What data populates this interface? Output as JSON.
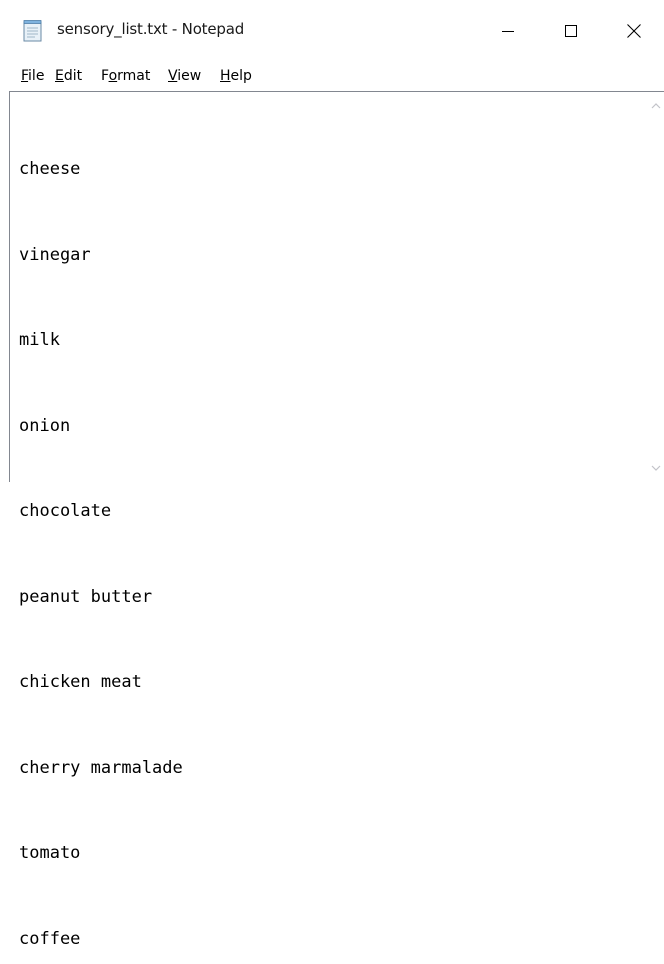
{
  "window": {
    "title": "sensory_list.txt - Notepad",
    "app_icon": "notepad-icon",
    "controls": {
      "minimize_icon": "minimize-icon",
      "maximize_icon": "maximize-icon",
      "close_icon": "close-icon"
    }
  },
  "menu": {
    "items": [
      {
        "mnemonic": "F",
        "rest": "ile"
      },
      {
        "mnemonic": "E",
        "rest": "dit"
      },
      {
        "pre": "F",
        "mnemonic": "o",
        "rest": "rmat"
      },
      {
        "mnemonic": "V",
        "rest": "iew"
      },
      {
        "mnemonic": "H",
        "rest": "elp"
      }
    ]
  },
  "document": {
    "lines": [
      "cheese",
      "vinegar",
      "milk",
      "onion",
      "chocolate",
      "peanut butter",
      "chicken meat",
      "cherry marmalade",
      "tomato",
      "coffee"
    ]
  },
  "colors": {
    "border": "#828790",
    "text": "#000000",
    "scroll_arrow": "#c2c3c9"
  }
}
